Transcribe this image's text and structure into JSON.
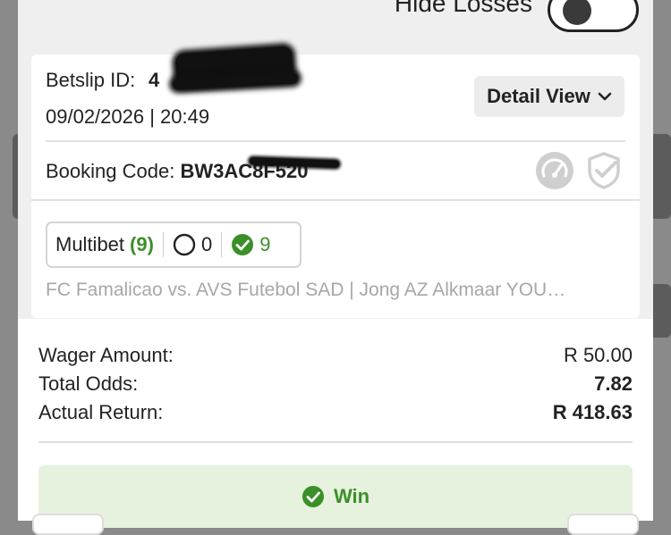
{
  "header": {
    "hide_losses_label": "Hide Losses",
    "hide_losses_on": false
  },
  "bet": {
    "betslip_id_label": "Betslip ID:",
    "betslip_id_visible": "4",
    "datetime": "09/02/2026 | 20:49",
    "detail_view_label": "Detail View",
    "booking_code_label": "Booking Code:",
    "booking_code_value": "BW3AC8F520",
    "type_label": "Multibet",
    "type_count": "(9)",
    "open_count": "0",
    "won_count": "9",
    "events_text": "FC Famalicao vs. AVS Futebol SAD | Jong AZ Alkmaar YOU…"
  },
  "summary": {
    "wager_label": "Wager Amount:",
    "wager_value": "R 50.00",
    "odds_label": "Total Odds:",
    "odds_value": "7.82",
    "return_label": "Actual Return:",
    "return_value": "R 418.63",
    "result_label": "Win"
  },
  "colors": {
    "win_green": "#3b8f28",
    "win_bg": "#e6f2de"
  },
  "icons": [
    "gauge-icon",
    "shield-check-icon",
    "chevron-down-icon",
    "circle-outline-icon",
    "check-circle-icon"
  ]
}
